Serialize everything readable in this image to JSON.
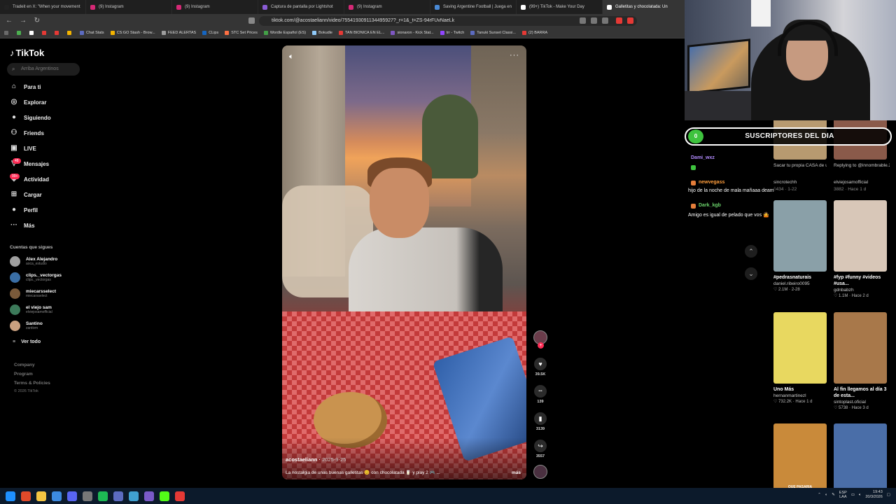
{
  "browser": {
    "tabs": [
      {
        "label": "Tradeit en X: \"When your movement",
        "color": "#222222"
      },
      {
        "label": "(9) Instagram",
        "color": "#d62976"
      },
      {
        "label": "(9) Instagram",
        "color": "#d62976"
      },
      {
        "label": "Captura de pantalla por Lightshot",
        "color": "#8a5cd6"
      },
      {
        "label": "(9) Instagram",
        "color": "#d62976"
      },
      {
        "label": "Saving Argentine Football | Juega en",
        "color": "#4a8ad6"
      },
      {
        "label": "(99+) TikTok - Make Your Day",
        "color": "#ffffff"
      },
      {
        "label": "Galletitas y chocolatada: Un",
        "color": "#ffffff"
      }
    ],
    "url": "tiktok.com/@acostaeliann/video/7554193091134495927?_r=1&_t=ZS-94rFUvNaeLk",
    "bookmarks": [
      {
        "label": "",
        "color": "#6a6a6a"
      },
      {
        "label": "",
        "color": "#4caf50"
      },
      {
        "label": "",
        "color": "#ffffff"
      },
      {
        "label": "",
        "color": "#e53935"
      },
      {
        "label": "",
        "color": "#e53935"
      },
      {
        "label": "",
        "color": "#f4b400"
      },
      {
        "label": "Chat Stats",
        "color": "#5c6bc0"
      },
      {
        "label": "CS:GO Stash - Brow...",
        "color": "#f4b400"
      },
      {
        "label": "FEED ALERTAS",
        "color": "#9e9e9e"
      },
      {
        "label": "CLips",
        "color": "#1565c0"
      },
      {
        "label": "STC Set Prices",
        "color": "#ff7043"
      },
      {
        "label": "Wordle Español (ES)",
        "color": "#43a047"
      },
      {
        "label": "Bokudle",
        "color": "#90caf9"
      },
      {
        "label": "TAN BIONICA EN EL...",
        "color": "#e53935"
      },
      {
        "label": "sionaron - Kick Stat...",
        "color": "#7e57c2"
      },
      {
        "label": "trr - Twitch",
        "color": "#9146ff"
      },
      {
        "label": "Tanuki Sunset Classi...",
        "color": "#5c6bc0"
      },
      {
        "label": "(2) BARRA",
        "color": "#e53935"
      }
    ]
  },
  "tiktok": {
    "logo": "TikTok",
    "search_placeholder": "Arriba Argentinos",
    "nav": [
      {
        "label": "Para ti",
        "icon": "home-icon",
        "glyph": "⌂"
      },
      {
        "label": "Explorar",
        "icon": "compass-icon",
        "glyph": "◎"
      },
      {
        "label": "Siguiendo",
        "icon": "following-avatar-icon",
        "glyph": "●"
      },
      {
        "label": "Friends",
        "icon": "friends-icon",
        "glyph": "⚇"
      },
      {
        "label": "LIVE",
        "icon": "live-icon",
        "glyph": "▣"
      },
      {
        "label": "Mensajes",
        "icon": "messages-icon",
        "glyph": "▽"
      },
      {
        "label": "Actividad",
        "icon": "activity-icon",
        "glyph": "◈"
      },
      {
        "label": "Cargar",
        "icon": "upload-icon",
        "glyph": "⊞"
      },
      {
        "label": "Perfil",
        "icon": "profile-icon",
        "glyph": "●"
      },
      {
        "label": "Más",
        "icon": "more-icon",
        "glyph": "···"
      }
    ],
    "badges": {
      "mensajes": "48",
      "actividad": "99+"
    },
    "following_title": "Cuentas que sigues",
    "following": [
      {
        "name": "Alex Alejandro",
        "handle": "aoca_estudio",
        "color": "#a0a0a0"
      },
      {
        "name": "clips._vectorgas",
        "handle": "clips._vectorgas",
        "color": "#3a6ea5"
      },
      {
        "name": "miecarsselect",
        "handle": "miecarsselect",
        "color": "#7a5a3a"
      },
      {
        "name": "el viejo sam",
        "handle": "elviejosamofficial",
        "color": "#3c7a5a"
      },
      {
        "name": "Santino",
        "handle": "zantivm",
        "color": "#c9a080"
      }
    ],
    "see_all": "Ver todo",
    "footer": [
      "Company",
      "Program",
      "Terms & Policies",
      "© 2026 TikTok"
    ]
  },
  "video": {
    "author": "acostaeliann",
    "date": "2025-9-25",
    "caption": "La nostalgia de unas buenas galletitas 😊 con chocolatada 🥛 y play 2 🎮 ...",
    "more": "más",
    "actions": [
      {
        "name": "like",
        "glyph": "♥",
        "count": "39.5K"
      },
      {
        "name": "comment",
        "glyph": "•••",
        "count": "139"
      },
      {
        "name": "save",
        "glyph": "▮",
        "count": "3139"
      },
      {
        "name": "share",
        "glyph": "↪",
        "count": "3557"
      }
    ]
  },
  "stream_overlay": {
    "sub_count": "0",
    "sub_title": "SUSCRIPTORES DEL DIA",
    "chat": [
      {
        "user": "Dami_wxz",
        "user_color": "#b38cff",
        "message": ""
      },
      {
        "user": "newvegass",
        "user_color": "#ff9e3d",
        "message": "hijo de la noche de mala mañaaa deam"
      },
      {
        "user": "Dark_kgb",
        "user_color": "#6bd36b",
        "message": "Amigo es igual de pelado que vos 🤷"
      }
    ]
  },
  "related": {
    "partial_top": [
      {
        "title": "Sacar tu propia CASA de un...",
        "user": "sincrotechh",
        "stats": "6434 · 1-22"
      },
      {
        "title": "Replying to @innombrable.2...",
        "user": "elviejosamofficial",
        "stats": "3882 · Hace 1 d"
      }
    ],
    "cards": [
      {
        "title": "#pedrasnaturais",
        "user": "daniel.ribeiro0095",
        "stats": "♡ 2.1M · 2-28",
        "color": "#8aa0a8"
      },
      {
        "title": "#fyp #funny #videos #usa...",
        "user": "gdnbabzh",
        "stats": "♡ 1.1M · Hace 2 d",
        "color": "#d8c7b8"
      },
      {
        "title": "Uno Más",
        "user": "hernanmartinezl",
        "stats": "♡ 732.2K · Hace 1 d",
        "color": "#e8d860"
      },
      {
        "title": "Al fin llegamos al día 3 de esta...",
        "user": "sintoplast.oficial",
        "stats": "♡ 5738 · Hace 3 d",
        "color": "#a8784a"
      },
      {
        "title": "",
        "user": "",
        "stats": "",
        "color": "#c98a3a",
        "overlay_text": "QUE PASARIA"
      },
      {
        "title": "",
        "user": "",
        "stats": "",
        "color": "#4a6ea8",
        "overlay_text": ""
      }
    ]
  },
  "taskbar": {
    "apps": [
      "#1e90ff",
      "#e04a2a",
      "#f4c542",
      "#3c8ae0",
      "#5865f2",
      "#777777",
      "#1db954",
      "#5c6bc0",
      "#40a0d0",
      "#7a5ac8",
      "#53fc18",
      "#e53935"
    ],
    "lang": "ESP",
    "lang2": "LAA",
    "time": "19:43",
    "date": "20/3/2026"
  }
}
